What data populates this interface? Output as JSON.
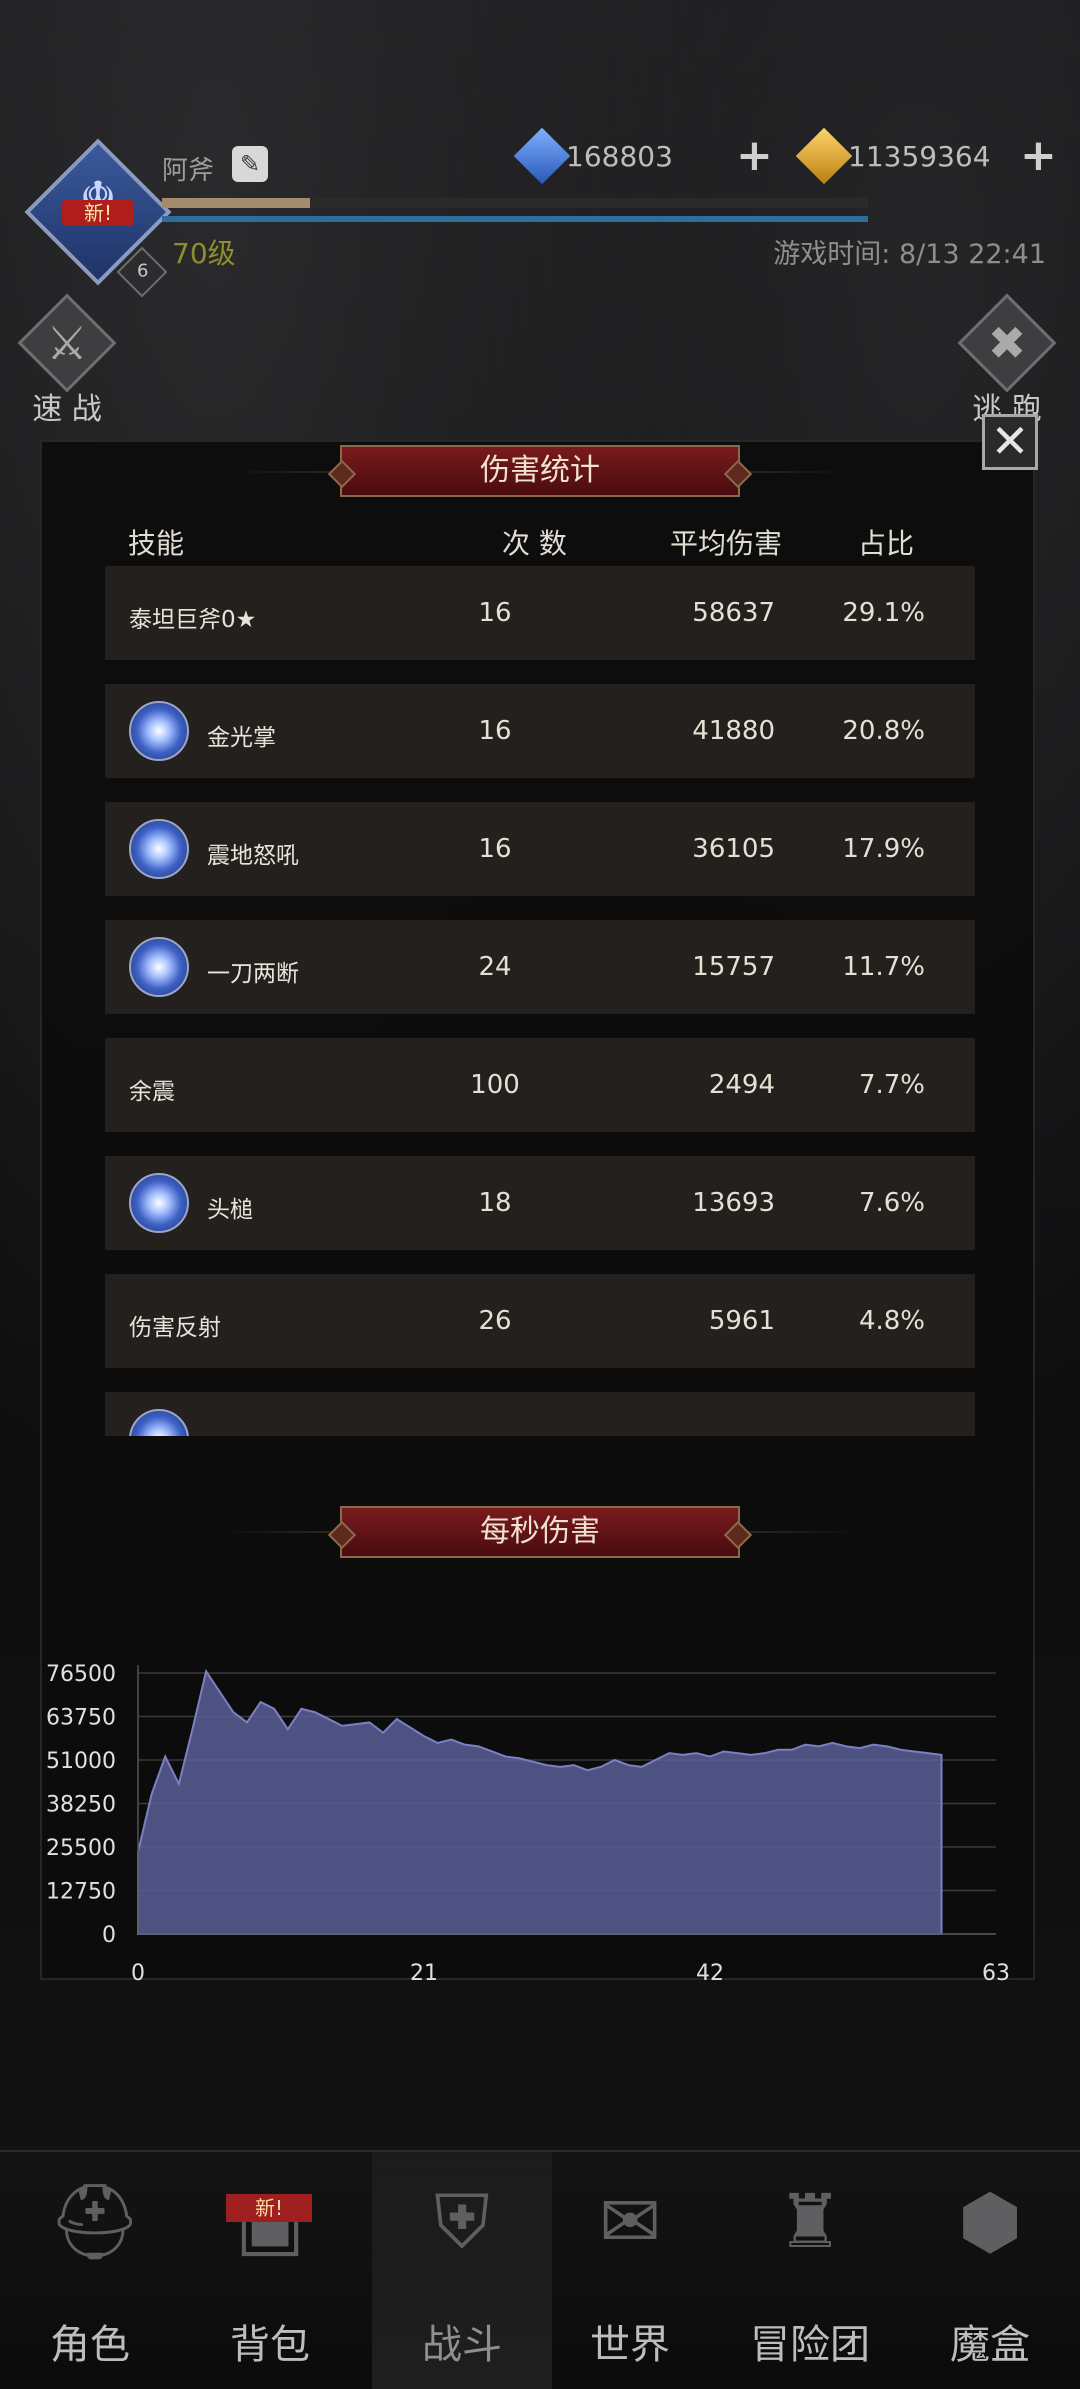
{
  "header": {
    "player_name": "阿斧",
    "new_badge": "新!",
    "avatar_level": "6",
    "level": "70级",
    "xp_fraction": 0.21,
    "gems_blue": "168803",
    "gems_gold": "11359364",
    "game_time": "游戏时间: 8/13 22:41"
  },
  "side_buttons": {
    "left_label": "速 战",
    "right_label": "逃 跑"
  },
  "damage_stats": {
    "title": "伤害统计",
    "columns": [
      "技能",
      "次 数",
      "平均伤害",
      "占比"
    ],
    "rows": [
      {
        "name": "泰坦巨斧0★",
        "count": "16",
        "avg": "58637",
        "pct": "29.1%",
        "icon": ""
      },
      {
        "name": "金光掌",
        "count": "16",
        "avg": "41880",
        "pct": "20.8%",
        "icon": "palm-skill-icon"
      },
      {
        "name": "震地怒吼",
        "count": "16",
        "avg": "36105",
        "pct": "17.9%",
        "icon": "roar-skill-icon"
      },
      {
        "name": "一刀两断",
        "count": "24",
        "avg": "15757",
        "pct": "11.7%",
        "icon": "slash-skill-icon"
      },
      {
        "name": "余震",
        "count": "100",
        "avg": "2494",
        "pct": "7.7%",
        "icon": ""
      },
      {
        "name": "头槌",
        "count": "18",
        "avg": "13693",
        "pct": "7.6%",
        "icon": "headbutt-skill-icon"
      },
      {
        "name": "伤害反射",
        "count": "26",
        "avg": "5961",
        "pct": "4.8%",
        "icon": ""
      },
      {
        "name": "",
        "count": "",
        "avg": "",
        "pct": "",
        "icon": "skill-icon"
      }
    ]
  },
  "dps": {
    "title": "每秒伤害"
  },
  "chart_data": {
    "type": "area",
    "title": "每秒伤害",
    "x": [
      0,
      1,
      2,
      3,
      4,
      5,
      6,
      7,
      8,
      9,
      10,
      11,
      12,
      13,
      14,
      15,
      16,
      17,
      18,
      19,
      20,
      21,
      22,
      23,
      24,
      25,
      26,
      27,
      28,
      29,
      30,
      31,
      32,
      33,
      34,
      35,
      36,
      37,
      38,
      39,
      40,
      41,
      42,
      43,
      44,
      45,
      46,
      47,
      48,
      49,
      50,
      51,
      52,
      53,
      54,
      55,
      56,
      57,
      58,
      59
    ],
    "values": [
      24000,
      41000,
      52000,
      44000,
      60000,
      77000,
      71000,
      65000,
      62000,
      68000,
      66000,
      60000,
      66000,
      65000,
      63000,
      61000,
      61500,
      62000,
      59000,
      63000,
      60500,
      58000,
      56000,
      57000,
      55500,
      55000,
      53500,
      52000,
      51500,
      50500,
      49500,
      49000,
      49500,
      48000,
      49000,
      51000,
      49500,
      49000,
      51000,
      53000,
      52500,
      53000,
      52000,
      53500,
      53000,
      52500,
      53000,
      54000,
      54000,
      55500,
      55000,
      56000,
      55000,
      54500,
      55500,
      55000,
      54000,
      53500,
      53000,
      52500
    ],
    "xticks": [
      0,
      21,
      42,
      63
    ],
    "yticks": [
      0,
      12750,
      25500,
      38250,
      51000,
      63750,
      76500
    ],
    "xlim": [
      0,
      63
    ],
    "ylim": [
      0,
      76500
    ],
    "grid": true,
    "fill_color": "#5a5f99",
    "line_color": "#7a80c0"
  },
  "nav": {
    "items": [
      {
        "label": "角色",
        "icon": "helmet-icon",
        "new": ""
      },
      {
        "label": "背包",
        "icon": "backpack-icon",
        "new": "新!"
      },
      {
        "label": "战斗",
        "icon": "shield-sword-icon",
        "new": ""
      },
      {
        "label": "世界",
        "icon": "map-scroll-icon",
        "new": ""
      },
      {
        "label": "冒险团",
        "icon": "castle-icon",
        "new": ""
      },
      {
        "label": "魔盒",
        "icon": "magic-box-icon",
        "new": ""
      }
    ],
    "active_index": 2
  }
}
